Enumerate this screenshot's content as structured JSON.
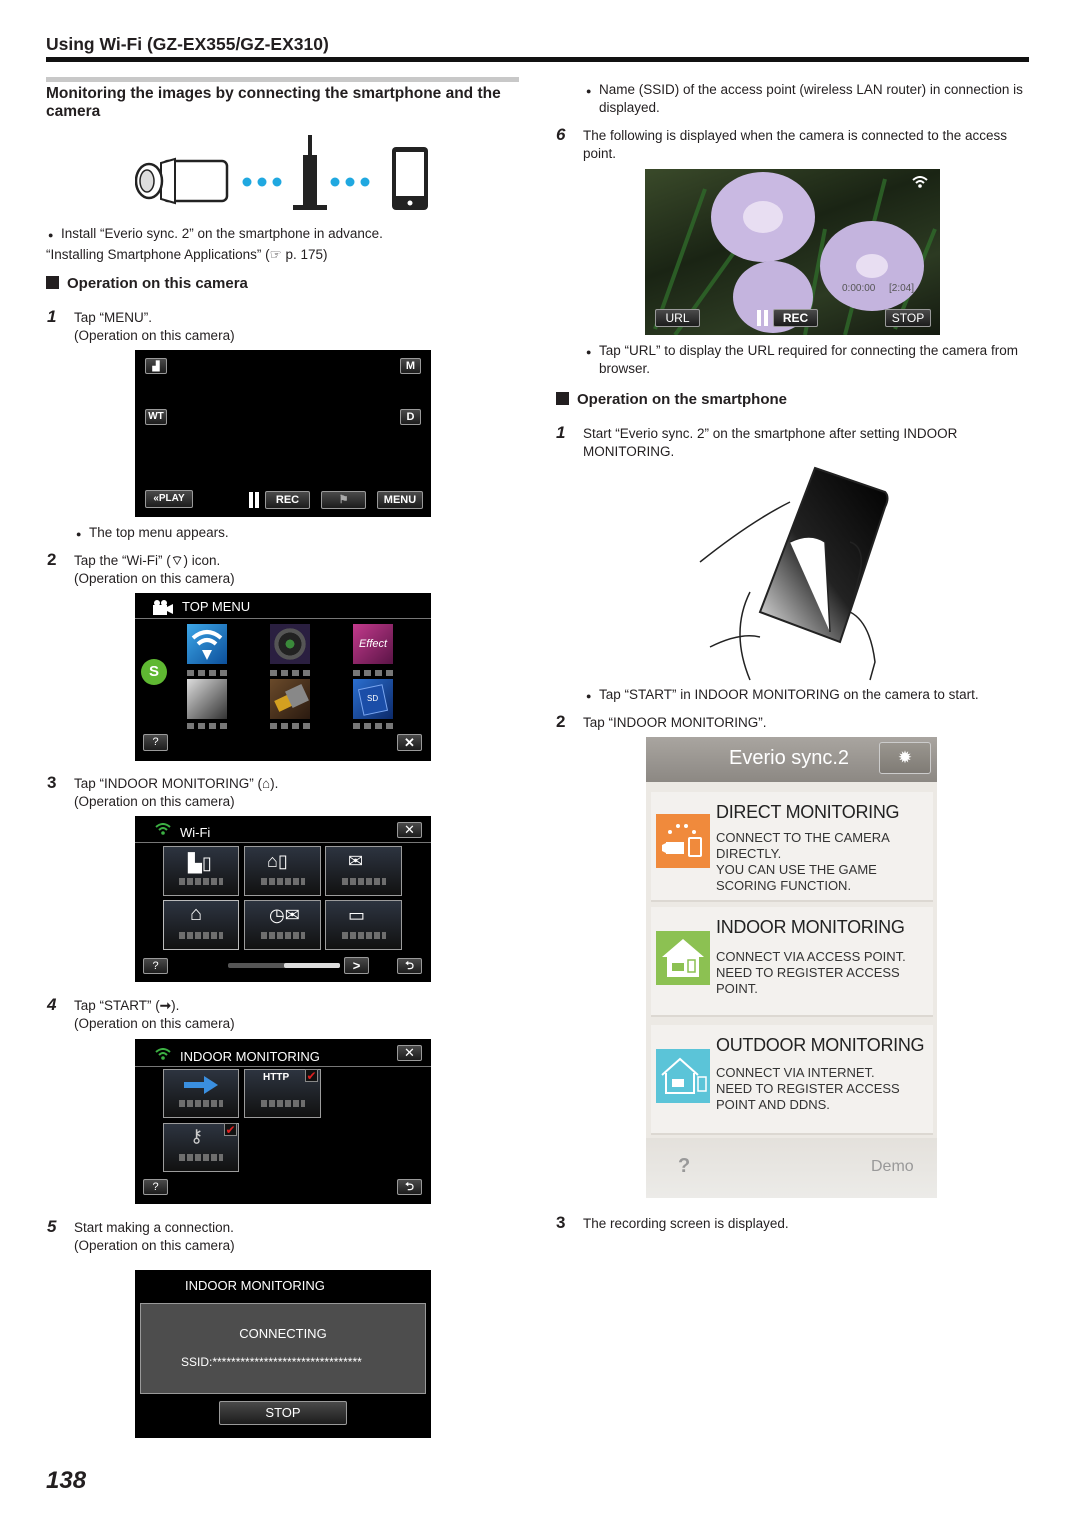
{
  "header": {
    "title": "Using Wi-Fi (GZ-EX355/GZ-EX310)"
  },
  "section": {
    "title": "Monitoring the images by connecting the smartphone and the camera"
  },
  "intro": {
    "bullet": "Install “Everio sync. 2” on the smartphone in advance.",
    "reference": "“Installing Smartphone Applications” (☞ p. 175)"
  },
  "camera_ops": {
    "heading": "Operation on this camera",
    "steps": [
      {
        "num": "1",
        "text": "Tap “MENU”.",
        "sub": "(Operation on this camera)",
        "note": "The top menu appears."
      },
      {
        "num": "2",
        "text_before": "Tap the “Wi-Fi” (",
        "text_after": ") icon.",
        "sub": "(Operation on this camera)"
      },
      {
        "num": "3",
        "text_before": "Tap “INDOOR MONITORING” (",
        "text_after": ").",
        "sub": "(Operation on this camera)"
      },
      {
        "num": "4",
        "text_before": "Tap “START” (",
        "text_after": ").",
        "sub": "(Operation on this camera)"
      },
      {
        "num": "5",
        "text": "Start making a connection.",
        "sub": "(Operation on this camera)",
        "note": "Name (SSID) of the access point (wireless LAN router) in connection is displayed."
      },
      {
        "num": "6",
        "text": "The following is displayed when the camera is connected to the access point.",
        "note": "Tap “URL” to display the URL required for connecting the camera from browser."
      }
    ]
  },
  "screen_rec": {
    "buttons": {
      "mode": "▟",
      "m": "M",
      "wt": "WT",
      "d": "D",
      "play": "«PLAY",
      "rec": "REC",
      "menu": "MENU"
    }
  },
  "screen_top_menu": {
    "title": "TOP MENU",
    "help": "?",
    "close": "✕"
  },
  "screen_wifi": {
    "title": "Wi-Fi",
    "help": "?",
    "scroll_position": 0.5
  },
  "screen_indoor": {
    "title": "INDOOR MONITORING",
    "http_label": "HTTP",
    "help": "?"
  },
  "screen_connecting": {
    "title": "INDOOR MONITORING",
    "status": "CONNECTING",
    "ssid": "SSID:********************************",
    "stop": "STOP"
  },
  "screen_live": {
    "url": "URL",
    "rec": "REC",
    "stop": "STOP",
    "timecode": "0:00:00",
    "remaining": "[2:04]"
  },
  "phone_ops": {
    "heading": "Operation on the smartphone",
    "steps": [
      {
        "num": "1",
        "text": "Start “Everio sync. 2” on the smartphone after setting INDOOR MONITORING.",
        "note": "Tap “START” in INDOOR MONITORING on the camera to start."
      },
      {
        "num": "2",
        "text": "Tap “INDOOR MONITORING”."
      },
      {
        "num": "3",
        "text": "The recording screen is displayed."
      }
    ]
  },
  "app": {
    "title": "Everio sync.2",
    "cards": [
      {
        "title": "DIRECT MONITORING",
        "desc": [
          "CONNECT TO THE CAMERA",
          "DIRECTLY.",
          "YOU CAN USE THE GAME",
          "SCORING FUNCTION."
        ],
        "color": "#f08a3c"
      },
      {
        "title": "INDOOR MONITORING",
        "desc": [
          "CONNECT VIA ACCESS POINT.",
          "NEED TO REGISTER ACCESS",
          "POINT."
        ],
        "color": "#8cc152"
      },
      {
        "title": "OUTDOOR MONITORING",
        "desc": [
          "CONNECT VIA INTERNET.",
          "NEED TO REGISTER ACCESS",
          "POINT AND DDNS."
        ],
        "color": "#5bc4d8"
      }
    ],
    "help": "?",
    "demo": "Demo"
  },
  "footer": {
    "page_number": "138"
  },
  "colors": {
    "dot_blue": "#20a8e0",
    "wifi_green": "#3cb043",
    "check_red": "#e02020"
  }
}
